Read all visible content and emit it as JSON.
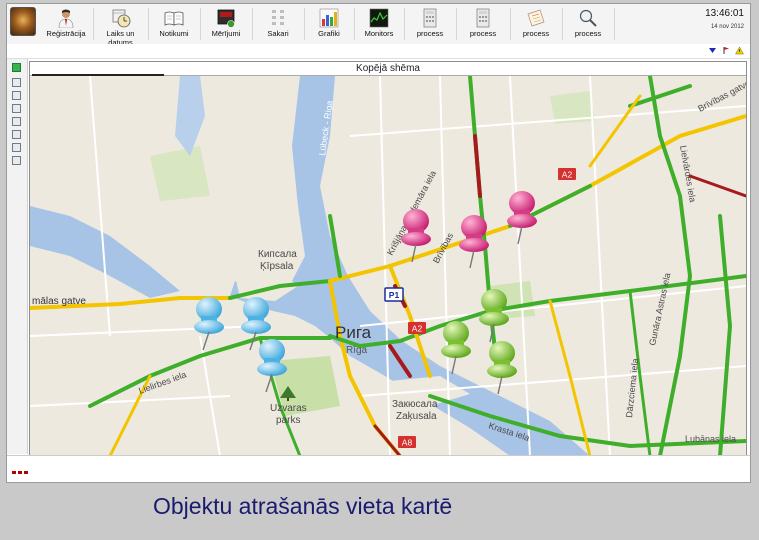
{
  "toolbar": {
    "buttons": [
      {
        "label": "Reģistrācija",
        "icon": "person-icon"
      },
      {
        "label": "Laiks un datums",
        "icon": "clock-calendar-icon"
      },
      {
        "label": "Notikumi",
        "icon": "book-icon"
      },
      {
        "label": "Mērījumi",
        "icon": "meter-icon"
      },
      {
        "label": "Sakari",
        "icon": "network-icon"
      },
      {
        "label": "Grafiki",
        "icon": "bar-chart-icon"
      },
      {
        "label": "Monitors",
        "icon": "monitor-icon"
      },
      {
        "label": "process",
        "icon": "calculator-icon"
      },
      {
        "label": "process",
        "icon": "calculator-icon"
      },
      {
        "label": "process",
        "icon": "notepad-icon"
      },
      {
        "label": "process",
        "icon": "magnifier-icon"
      }
    ],
    "time": "13:46:01",
    "date": "14 nov 2012"
  },
  "map": {
    "title": "Kopējā shēma",
    "labels": {
      "lubeck": "Lübeck - Riga",
      "kuncana": "Кипсала",
      "kipsala": "Ķīpsala",
      "riga_ru": "Рига",
      "riga": "Rīga",
      "zakusala_ru": "Закюсала",
      "zakusala": "Zaķusala",
      "uzvaras": "Uzvaras",
      "parks": "parks",
      "malas": "mālas gatve",
      "lielirbes": "Lielirbes iela",
      "krisjana": "Krišjāņa Valdemāra iela",
      "brivibas": "Brīvības gatve",
      "lielvardes": "Lielvārdes iela",
      "gunara": "Gunāra Astras iela",
      "darzciema": "Dārzciema iela",
      "krasta": "Krasta iela",
      "lubanas": "Lubānas iela",
      "brivibas_top": "Brīvības",
      "a2_1": "A2",
      "a2_2": "A2",
      "a8": "A8",
      "p1": "P1"
    }
  },
  "caption": "Objektu atrašanās vieta kartē",
  "colors": {
    "water": "#a7c4e6",
    "land": "#ede9df",
    "park": "#c8dfa8",
    "traffic_green": "#3fae2a",
    "traffic_yellow": "#f2c500",
    "traffic_red": "#a51b1b",
    "pin_pink": "#e0438f",
    "pin_blue": "#6fc2ea",
    "pin_green": "#8fce3a",
    "caption": "#1a1a6e"
  }
}
